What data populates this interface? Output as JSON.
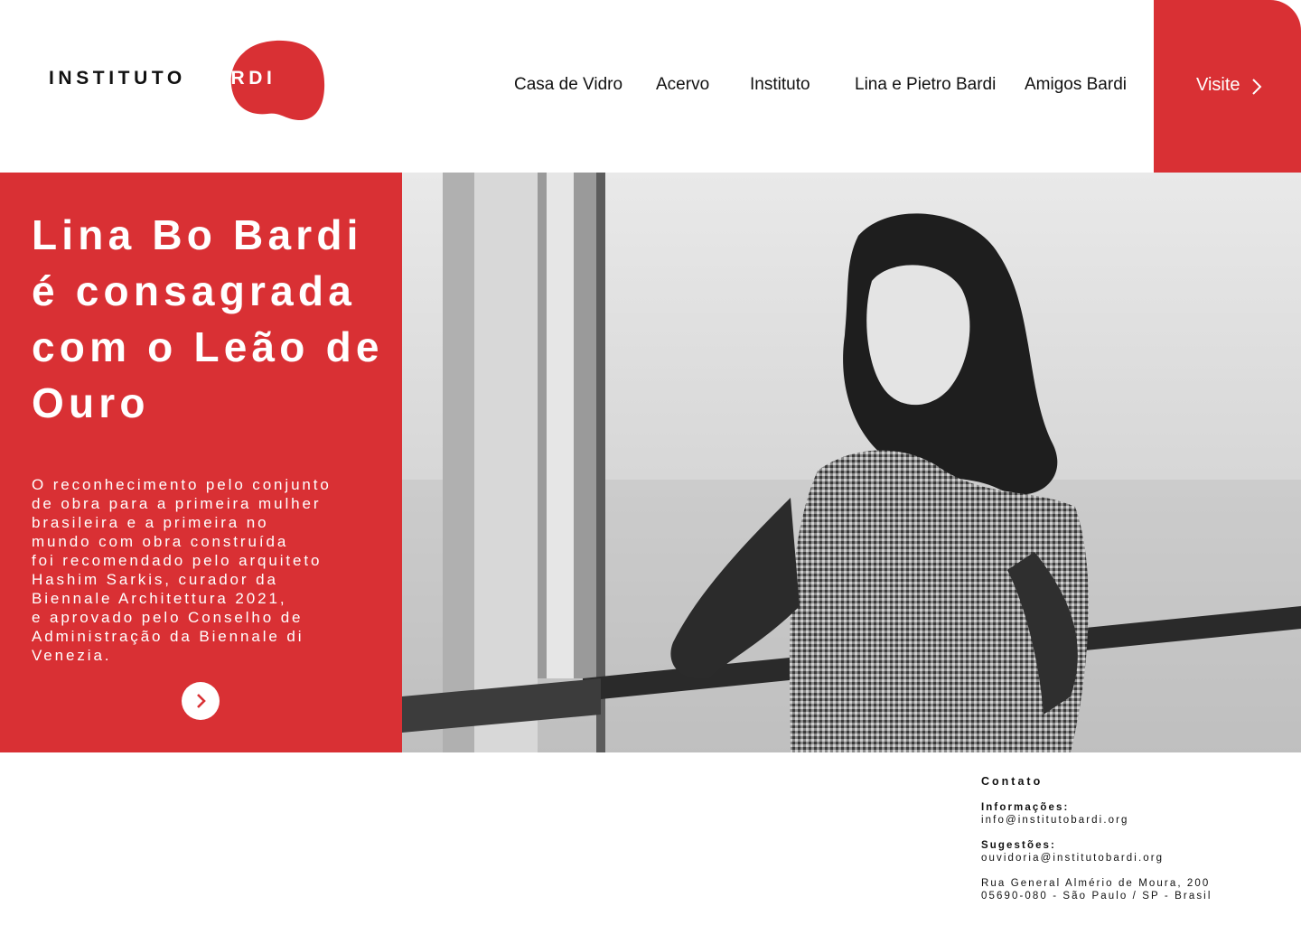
{
  "brand": {
    "logo_left": "INSTITUTO",
    "logo_right": "BARDI",
    "accent_color": "#d93034"
  },
  "nav": {
    "items": [
      {
        "label": "Casa de Vidro"
      },
      {
        "label": "Acervo"
      },
      {
        "label": "Instituto"
      },
      {
        "label": "Lina e Pietro Bardi"
      },
      {
        "label": "Amigos Bardi"
      }
    ],
    "visit_label": "Visite",
    "visit_icon": "chevron-right-icon"
  },
  "hero": {
    "title": "Lina Bo Bardi é consagrada com o Leão de Ouro",
    "body": "O reconhecimento pelo conjunto\nde obra para a primeira mulher\nbrasileira e a primeira no\nmundo com obra construída\nfoi recomendado pelo arquiteto\nHashim Sarkis, curador da\nBiennale Architettura 2021,\ne aprovado pelo Conselho de\nAdministração da Biennale di\nVenezia.",
    "next_icon": "chevron-right-icon",
    "photo": "black-and-white photograph of a woman leaning on a ship railing by the sea"
  },
  "contact": {
    "heading": "Contato",
    "info_label": "Informações:",
    "info_email": "info@institutobardi.org",
    "suggest_label": "Sugestões:",
    "suggest_email": "ouvidoria@institutobardi.org",
    "address_line1": "Rua General Almério de Moura, 200",
    "address_line2": "05690-080 - São Paulo / SP - Brasil"
  }
}
